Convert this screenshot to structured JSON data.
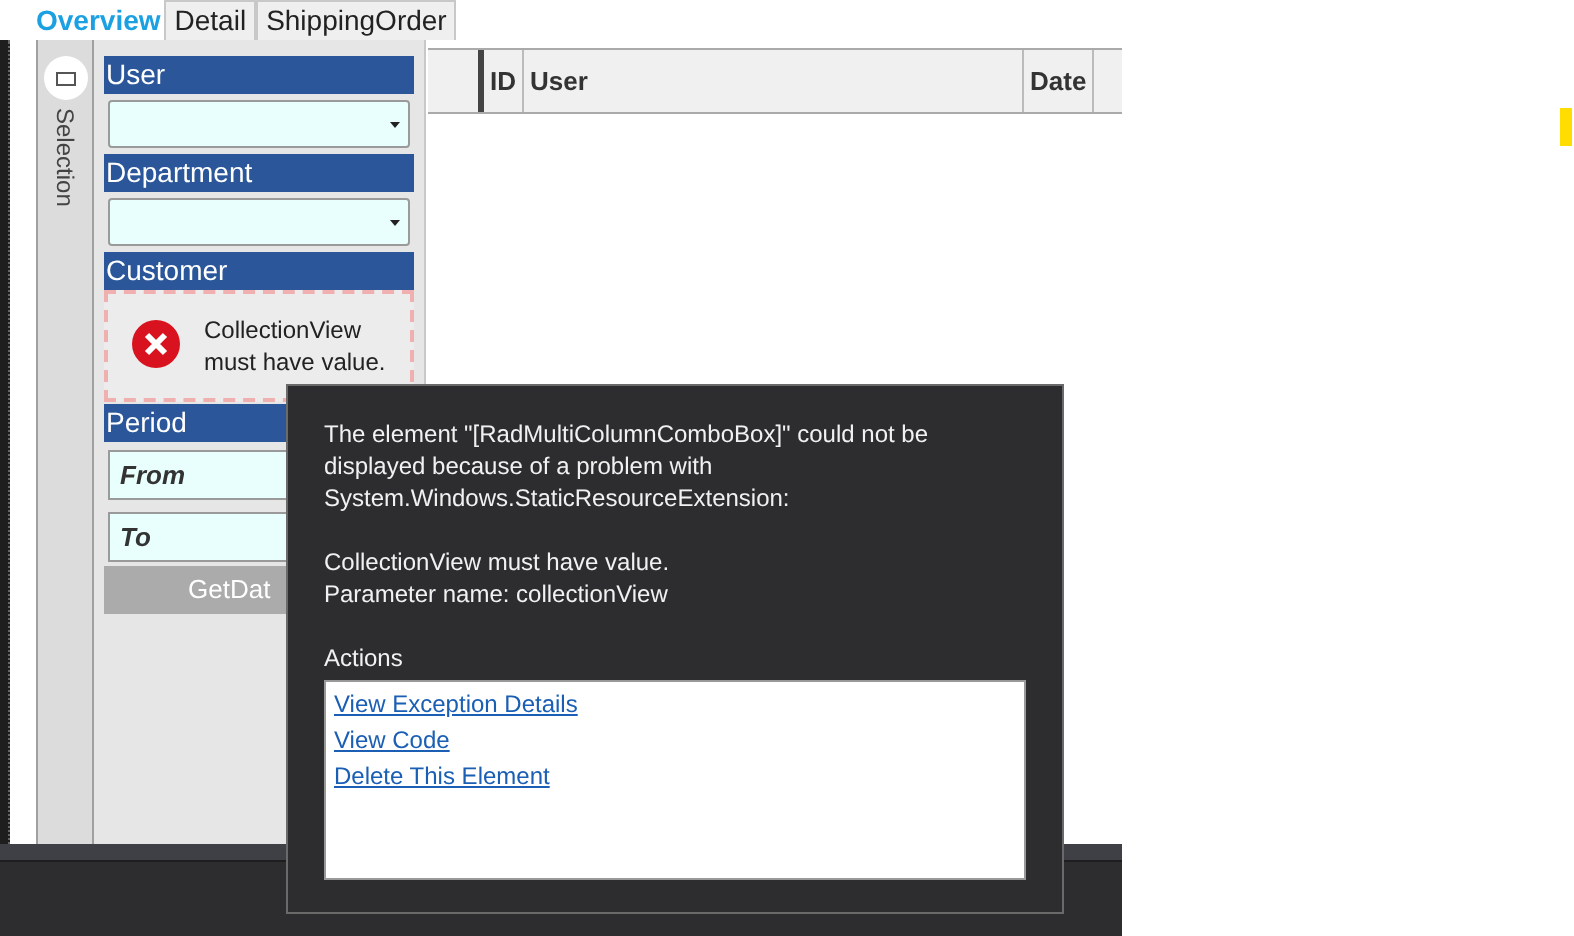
{
  "tabs": [
    {
      "label": "Overview",
      "selected": true
    },
    {
      "label": "Detail",
      "selected": false
    },
    {
      "label": "ShippingOrder",
      "selected": false
    }
  ],
  "selection_strip": {
    "label": "Selection"
  },
  "filter_panel": {
    "user": {
      "label": "User"
    },
    "department": {
      "label": "Department"
    },
    "customer": {
      "label": "Customer",
      "error": "CollectionView must have value."
    },
    "period": {
      "label": "Period",
      "from": {
        "placeholder": "From"
      },
      "to": {
        "placeholder": "To"
      }
    },
    "button": "GetDat"
  },
  "grid": {
    "columns": [
      "ID",
      "User",
      "Date"
    ]
  },
  "error_popup": {
    "message": "The element \"[RadMultiColumnComboBox]\" could not be displayed because of a problem with System.Windows.StaticResourceExtension:",
    "detail": [
      "CollectionView must have value.",
      "Parameter name: collectionView"
    ],
    "actions_title": "Actions",
    "actions": [
      "View Exception Details",
      "View Code",
      "Delete This Element"
    ]
  }
}
